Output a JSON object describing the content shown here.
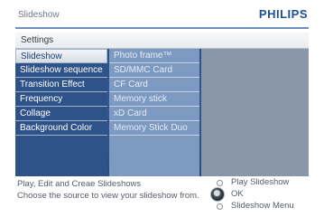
{
  "header": {
    "app_title": "Slideshow",
    "brand": "PHILIPS",
    "brand_color": "#1e4f9e"
  },
  "settings": {
    "label": "Settings"
  },
  "menu": {
    "items": [
      {
        "label": "Slideshow",
        "selected": true
      },
      {
        "label": "Slideshow sequence"
      },
      {
        "label": "Transition Effect"
      },
      {
        "label": "Frequency"
      },
      {
        "label": "Collage"
      },
      {
        "label": "Background Color"
      }
    ]
  },
  "sources": {
    "items": [
      {
        "label": "Photo frame™"
      },
      {
        "label": "SD/MMC Card"
      },
      {
        "label": "CF Card"
      },
      {
        "label": "Memory stick"
      },
      {
        "label": "xD Card"
      },
      {
        "label": "Memory Stick Duo"
      }
    ]
  },
  "footer": {
    "hint_line1": "Play, Edit and Creae Slideshows",
    "hint_line2": "Choose the source to view your slideshow from.",
    "legend": {
      "top_label": "Play Slideshow",
      "ok_label": "OK",
      "bottom_label": "Slideshow Menu"
    }
  }
}
